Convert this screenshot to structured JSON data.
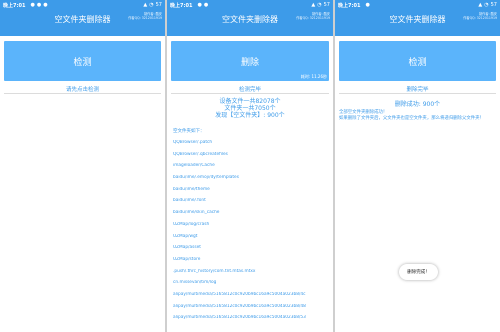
{
  "screen1": {
    "status": {
      "time": "晚上7:01",
      "battery": "57"
    },
    "appbar": {
      "title": "空文件夹删除器",
      "info1": "制作者: 酷安",
      "info2": "作者QQ: 3212011919"
    },
    "button": {
      "label": "检测"
    },
    "status_text": "请先点击检测"
  },
  "screen2": {
    "status": {
      "time": "晚上7:01",
      "battery": "57"
    },
    "appbar": {
      "title": "空文件夹删除器",
      "info1": "制作者: 酷安",
      "info2": "作者QQ: 3212011919"
    },
    "button": {
      "label": "删除",
      "elapsed": "耗时: 11.26秒"
    },
    "status_text": "检测完毕",
    "summary": {
      "line1": "设备文件一共82078个",
      "line2": "文件夹一共7050个",
      "line3": "发现【空文件夹】: 900个"
    },
    "list_header": "空文件夹如下：",
    "folders": [
      "QQBrowser/.patch",
      "QQBrowser/.qbcreatefiles",
      "imageloader/Cache",
      "baidu/ime/.emoji/dy/templates",
      "baidu/ime/theme",
      "baidu/ime/.font",
      "baidu/ime/skin_cache",
      "UZMap/log/crash",
      "UZMap/wgt",
      "UZMap/asset",
      "UZMap/store",
      ".push/.thrc_history/com.tnt.mtas.mtxx",
      "cn.missevan/tim/log",
      "alipay/multimedia/5165812c0c920b9bc16a9c5004a023b8/4c",
      "alipay/multimedia/5165812c0c920b9bc16a9c5004a023b8/48",
      "alipay/multimedia/5165812c0c920b9bc16a9c5004a023b8/53"
    ]
  },
  "screen3": {
    "status": {
      "time": "晚上7:01",
      "battery": "57"
    },
    "appbar": {
      "title": "空文件夹删除器",
      "info1": "制作者: 酷安",
      "info2": "作者QQ: 3212011919"
    },
    "button": {
      "label": "检测"
    },
    "status_text": "删除完毕",
    "result": "删除成功: 900个",
    "note": "全部空文件夹删除成功！\n如果删除了文件夹后，父文件夹也是空文件夹，那么将递归删除父文件夹！",
    "toast": "删除完成！"
  },
  "colors": {
    "primary": "#3d9be9",
    "button": "#5bb4fb",
    "text": "#3d9be9"
  }
}
